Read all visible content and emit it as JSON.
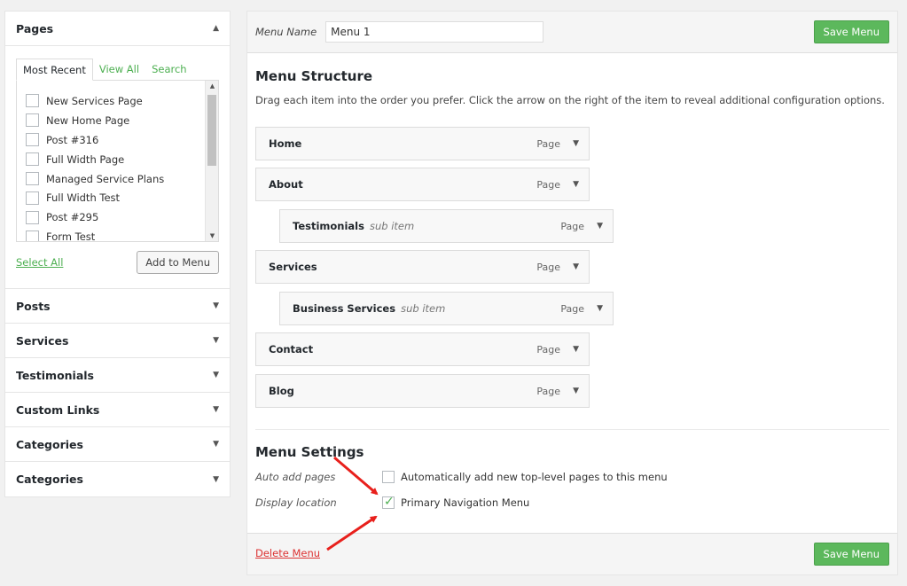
{
  "sidebar": {
    "pages_panel": {
      "title": "Pages",
      "tabs": [
        "Most Recent",
        "View All",
        "Search"
      ],
      "items": [
        "New Services Page",
        "New Home Page",
        "Post #316",
        "Full Width Page",
        "Managed Service Plans",
        "Full Width Test",
        "Post #295",
        "Form Test"
      ],
      "select_all": "Select All",
      "add_button": "Add to Menu"
    },
    "sections": [
      "Posts",
      "Services",
      "Testimonials",
      "Custom Links",
      "Categories",
      "Categories"
    ]
  },
  "menu_header": {
    "name_label": "Menu Name",
    "name_value": "Menu 1",
    "save_label": "Save Menu"
  },
  "structure": {
    "title": "Menu Structure",
    "description": "Drag each item into the order you prefer. Click the arrow on the right of the item to reveal additional configuration options.",
    "items": [
      {
        "title": "Home",
        "sub": "",
        "type": "Page"
      },
      {
        "title": "About",
        "sub": "",
        "type": "Page"
      },
      {
        "title": "Testimonials",
        "sub": "sub item",
        "type": "Page"
      },
      {
        "title": "Services",
        "sub": "",
        "type": "Page"
      },
      {
        "title": "Business Services",
        "sub": "sub item",
        "type": "Page"
      },
      {
        "title": "Contact",
        "sub": "",
        "type": "Page"
      },
      {
        "title": "Blog",
        "sub": "",
        "type": "Page"
      }
    ]
  },
  "settings": {
    "title": "Menu Settings",
    "auto_add_label": "Auto add pages",
    "auto_add_text": "Automatically add new top-level pages to this menu",
    "auto_add_checked": false,
    "location_label": "Display location",
    "location_text": "Primary Navigation Menu",
    "location_checked": true
  },
  "footer": {
    "delete_label": "Delete Menu",
    "save_label": "Save Menu"
  },
  "colors": {
    "accent_green": "#5cb85c",
    "link_green": "#4caf50",
    "delete_red": "#dc3232",
    "annotation_red": "#e8201c"
  }
}
